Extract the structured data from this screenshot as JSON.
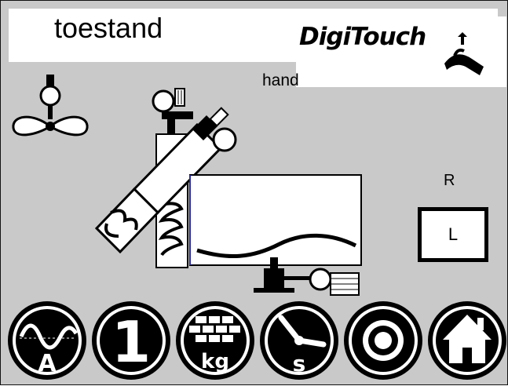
{
  "header": {
    "title": "toestand",
    "logo_text": "DigiTouch"
  },
  "status": {
    "mode": "hand",
    "direction_label": "R",
    "direction_button_label": "L"
  },
  "bottom_bar": {
    "buttons": [
      {
        "name": "current-sensor-button",
        "icon": "sine-wave-A-icon",
        "letter": "A"
      },
      {
        "name": "program-number-button",
        "icon": "number-1-icon",
        "digit": "1"
      },
      {
        "name": "weight-button",
        "icon": "bricks-kg-icon",
        "unit": "kg"
      },
      {
        "name": "timer-seconds-button",
        "icon": "clock-s-icon",
        "letter": "s"
      },
      {
        "name": "record-button",
        "icon": "target-icon"
      },
      {
        "name": "home-button",
        "icon": "house-icon"
      }
    ]
  },
  "colors": {
    "background": "#c9c9c9",
    "panel": "#ffffff",
    "icon": "#000000"
  }
}
